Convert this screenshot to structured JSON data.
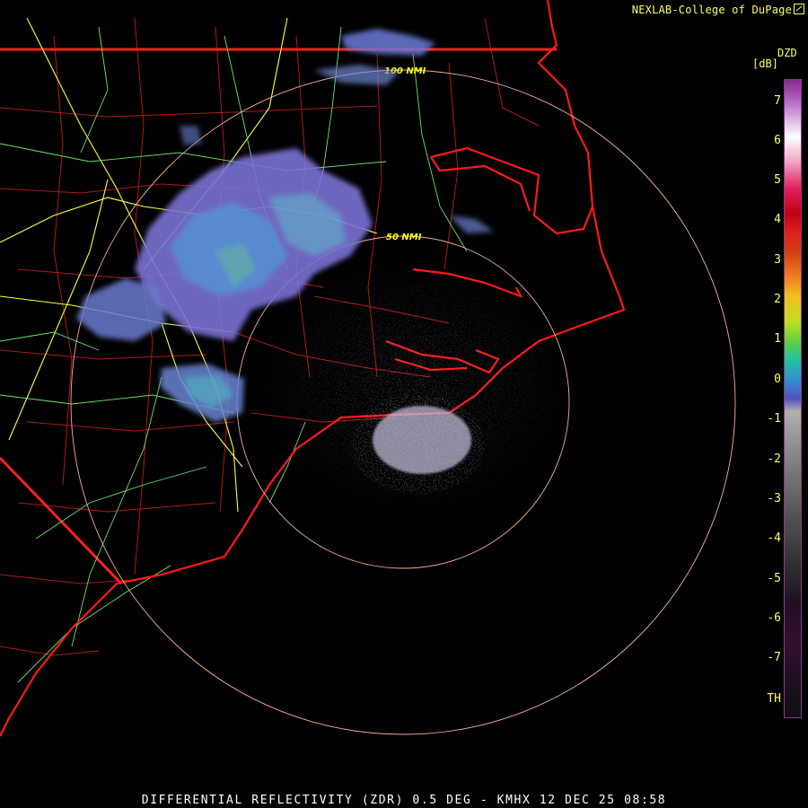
{
  "header": {
    "credit": "NEXLAB-College of DuPage"
  },
  "legend": {
    "product_code": "DZD",
    "unit": "[dB]",
    "ticks": [
      "7",
      "6",
      "5",
      "4",
      "3",
      "2",
      "1",
      "0",
      "-1",
      "-2",
      "-3",
      "-4",
      "-5",
      "-6",
      "-7",
      "TH"
    ]
  },
  "rings": {
    "inner_label": "50 NMI",
    "outer_label": "100 NMI"
  },
  "footer": {
    "title": "DIFFERENTIAL REFLECTIVITY (ZDR) 0.5 DEG - KMHX 12 DEC 25 08:58"
  },
  "colors": {
    "background": "#000000",
    "state_lines": "#ff2020",
    "county_lines": "#b01818",
    "highways": "#ffff40",
    "roads": "#70e070",
    "range_rings": "#f0b0a0"
  }
}
